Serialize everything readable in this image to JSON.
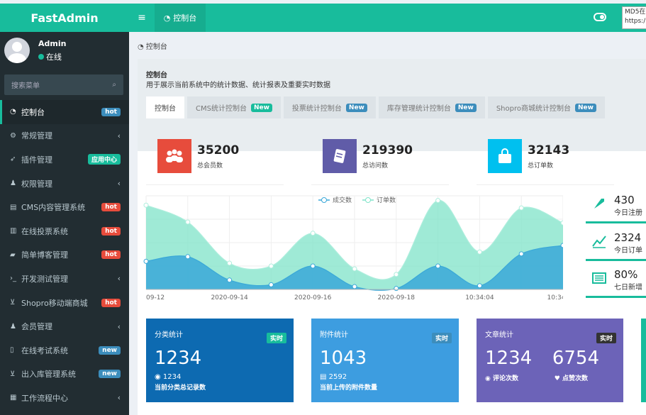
{
  "app": {
    "name": "FastAdmin"
  },
  "topbar": {
    "toggle": "≡",
    "tab_label": "控制台",
    "md5_text": "MD5在",
    "url_text": "https:/"
  },
  "user": {
    "name": "Admin",
    "status": "在线"
  },
  "search": {
    "placeholder": "搜索菜单"
  },
  "menu": [
    {
      "label": "控制台",
      "badge": "hot",
      "badge_type": "new",
      "active": true,
      "icon": "dashboard-icon"
    },
    {
      "label": "常规管理",
      "chevron": "‹",
      "icon": "cogs-icon"
    },
    {
      "label": "插件管理",
      "badge": "应用中心",
      "badge_type": "teal",
      "icon": "rocket-icon"
    },
    {
      "label": "权限管理",
      "chevron": "‹",
      "icon": "users-icon"
    },
    {
      "label": "CMS内容管理系统",
      "badge": "hot",
      "badge_type": "hot",
      "icon": "newspaper-icon"
    },
    {
      "label": "在线投票系统",
      "badge": "hot",
      "badge_type": "hot",
      "icon": "bar-chart-icon"
    },
    {
      "label": "简单博客管理",
      "badge": "hot",
      "badge_type": "hot",
      "icon": "book-icon"
    },
    {
      "label": "开发测试管理",
      "chevron": "‹",
      "icon": "terminal-icon"
    },
    {
      "label": "Shopro移动端商城",
      "badge": "hot",
      "badge_type": "hot",
      "icon": "cart-icon"
    },
    {
      "label": "会员管理",
      "chevron": "‹",
      "icon": "users-icon"
    },
    {
      "label": "在线考试系统",
      "badge": "new",
      "badge_type": "new",
      "icon": "file-icon"
    },
    {
      "label": "出入库管理系统",
      "badge": "new",
      "badge_type": "new",
      "icon": "cart-icon"
    },
    {
      "label": "工作流程中心",
      "chevron": "‹",
      "icon": "calendar-icon"
    }
  ],
  "breadcrumb": "控制台",
  "panel": {
    "title": "控制台",
    "desc": "用于展示当前系统中的统计数据、统计报表及重要实时数据"
  },
  "tabs": [
    {
      "label": "控制台",
      "active": true
    },
    {
      "label": "CMS统计控制台",
      "badge": "New",
      "badge_color": "#18bc9c"
    },
    {
      "label": "投票统计控制台",
      "badge": "New",
      "badge_color": "#3c8dbc"
    },
    {
      "label": "库存管理统计控制台",
      "badge": "New",
      "badge_color": "#3c8dbc"
    },
    {
      "label": "Shopro商城统计控制台",
      "badge": "New",
      "badge_color": "#3c8dbc"
    }
  ],
  "stats": [
    {
      "value": "35200",
      "label": "总会员数",
      "color": "#e74c3c",
      "icon": "users-icon"
    },
    {
      "value": "219390",
      "label": "总访问数",
      "color": "#605ca8",
      "icon": "book-icon"
    },
    {
      "value": "32143",
      "label": "总订单数",
      "color": "#00c0ef",
      "icon": "shopping-bag-icon"
    }
  ],
  "chart_data": {
    "type": "area",
    "x": [
      "09-12",
      "",
      "2020-09-14",
      "",
      "2020-09-16",
      "",
      "2020-09-18",
      "",
      "10:34:04",
      "",
      "10:34:"
    ],
    "xticks": [
      "09-12",
      "2020-09-14",
      "2020-09-16",
      "2020-09-18",
      "10:34:04",
      "10:34:"
    ],
    "series": [
      {
        "name": "成交数",
        "values": [
          300,
          350,
          100,
          50,
          250,
          30,
          10,
          250,
          40,
          380,
          470
        ],
        "color": "#3aa8d8"
      },
      {
        "name": "订单数",
        "values": [
          900,
          720,
          280,
          250,
          600,
          220,
          160,
          950,
          400,
          870,
          710
        ],
        "color": "#7fe3c8"
      }
    ],
    "ylim": [
      0,
      1000
    ],
    "legend": "top"
  },
  "side_stats": [
    {
      "value": "430",
      "label": "今日注册",
      "icon": "rocket-icon"
    },
    {
      "value": "2324",
      "label": "今日订单",
      "icon": "line-chart-icon"
    },
    {
      "value": "80%",
      "label": "七日新增",
      "icon": "list-icon"
    }
  ],
  "cards": [
    {
      "title": "分类统计",
      "tag": "实时",
      "value": "1234",
      "sub": "1234",
      "desc": "当前分类总记录数",
      "color": "#0d6ab1"
    },
    {
      "title": "附件统计",
      "tag": "实时",
      "value": "1043",
      "sub": "2592",
      "desc": "当前上传的附件数量",
      "color": "#3d9de0"
    },
    {
      "title": "文章统计",
      "tag": "实时",
      "value": "1234",
      "value2": "6754",
      "sub": "评论次数",
      "sub2": "点赞次数",
      "color": "#6c63b8"
    }
  ]
}
